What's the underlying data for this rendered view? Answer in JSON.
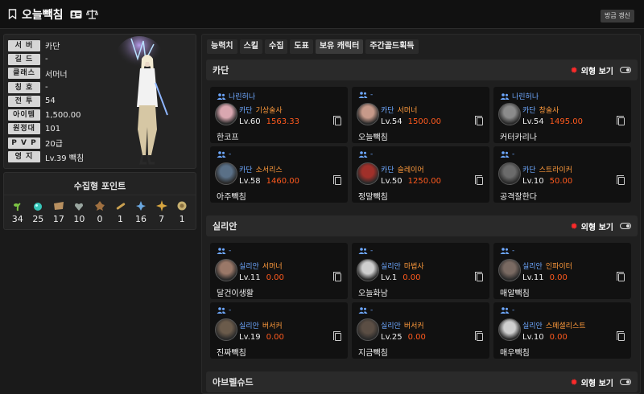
{
  "header": {
    "character_name": "오늘빽침",
    "refresh_label": "방금 갱신"
  },
  "profile": {
    "stats": [
      {
        "label": "서 버",
        "value": "카단"
      },
      {
        "label": "길 드",
        "value": "-"
      },
      {
        "label": "클래스",
        "value": "서머너"
      },
      {
        "label": "칭 호",
        "value": "-"
      },
      {
        "label": "전 투",
        "value": "54"
      },
      {
        "label": "아이템",
        "value": "1,500.00"
      },
      {
        "label": "원정대",
        "value": "101"
      },
      {
        "label": "P V P",
        "value": "20급"
      },
      {
        "label": "영 지",
        "value": "Lv.39 빽침"
      }
    ]
  },
  "collect": {
    "title": "수집형 포인트",
    "items": [
      {
        "icon": "mokoko-seed-icon",
        "value": "34",
        "color": "#7cc444"
      },
      {
        "icon": "island-heart-icon",
        "value": "25",
        "color": "#37c6b8"
      },
      {
        "icon": "great-art-icon",
        "value": "17",
        "color": "#b89060"
      },
      {
        "icon": "giant-heart-icon",
        "value": "10",
        "color": "#9aa6a0"
      },
      {
        "icon": "ignea-token-icon",
        "value": "0",
        "color": "#a07040"
      },
      {
        "icon": "sea-bounty-icon",
        "value": "1",
        "color": "#c9a050"
      },
      {
        "icon": "world-tree-leaf-icon",
        "value": "16",
        "color": "#6aa7e0"
      },
      {
        "icon": "orpheus-star-icon",
        "value": "7",
        "color": "#d8a640"
      },
      {
        "icon": "omnium-star-icon",
        "value": "1",
        "color": "#c7b070"
      }
    ]
  },
  "tabs": [
    "능력치",
    "스킬",
    "수집",
    "도표",
    "보유 캐릭터",
    "주간골드획득"
  ],
  "active_tab": "보유 캐릭터",
  "view_label": "외형 보기",
  "servers": [
    {
      "name": "카단",
      "characters": [
        {
          "guild": "나린허나",
          "server": "카단",
          "class": "기상술사",
          "level": "Lv.60",
          "item_level": "1563.33",
          "name": "한코프",
          "avatar_color": "#d9a7b0"
        },
        {
          "guild": "-",
          "server": "카단",
          "class": "서머너",
          "level": "Lv.54",
          "item_level": "1500.00",
          "name": "오늘빽침",
          "avatar_color": "#c79a8a"
        },
        {
          "guild": "나린허나",
          "server": "카단",
          "class": "창술사",
          "level": "Lv.54",
          "item_level": "1495.00",
          "name": "커터카리나",
          "avatar_color": "#8b8b8b"
        },
        {
          "guild": "-",
          "server": "카단",
          "class": "소서리스",
          "level": "Lv.58",
          "item_level": "1460.00",
          "name": "아주빽침",
          "avatar_color": "#5a7087"
        },
        {
          "guild": "-",
          "server": "카단",
          "class": "슬레이어",
          "level": "Lv.50",
          "item_level": "1250.00",
          "name": "정말빽침",
          "avatar_color": "#a0302a"
        },
        {
          "guild": "-",
          "server": "카단",
          "class": "스트라이커",
          "level": "Lv.10",
          "item_level": "50.00",
          "name": "공격잘한다",
          "avatar_color": "#6b6b6b"
        }
      ]
    },
    {
      "name": "실리안",
      "characters": [
        {
          "guild": "-",
          "server": "실리안",
          "class": "서머너",
          "level": "Lv.11",
          "item_level": "0.00",
          "name": "달건이생활",
          "avatar_color": "#9a7868"
        },
        {
          "guild": "-",
          "server": "실리안",
          "class": "마법사",
          "level": "Lv.1",
          "item_level": "0.00",
          "name": "오늘화남",
          "avatar_color": "#cfcfcf"
        },
        {
          "guild": "-",
          "server": "실리안",
          "class": "인파이터",
          "level": "Lv.11",
          "item_level": "0.00",
          "name": "매알빽침",
          "avatar_color": "#7a6a62"
        },
        {
          "guild": "-",
          "server": "실리안",
          "class": "버서커",
          "level": "Lv.19",
          "item_level": "0.00",
          "name": "진짜빽침",
          "avatar_color": "#6b5b4b"
        },
        {
          "guild": "-",
          "server": "실리안",
          "class": "버서커",
          "level": "Lv.25",
          "item_level": "0.00",
          "name": "지금빽침",
          "avatar_color": "#5b4e44"
        },
        {
          "guild": "-",
          "server": "실리안",
          "class": "스페셜리스트",
          "level": "Lv.10",
          "item_level": "0.00",
          "name": "매우빽침",
          "avatar_color": "#cfcfcf"
        }
      ]
    },
    {
      "name": "아브렐슈드",
      "characters": []
    }
  ]
}
